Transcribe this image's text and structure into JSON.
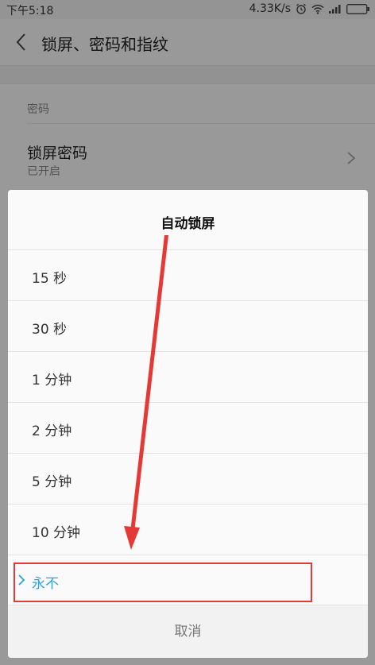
{
  "status_bar": {
    "time": "下午5:18",
    "speed": "4.33K/s"
  },
  "header": {
    "title": "锁屏、密码和指纹"
  },
  "background": {
    "section_label": "密码",
    "lock_password": {
      "title": "锁屏密码",
      "status": "已开启"
    }
  },
  "dialog": {
    "title": "自动锁屏",
    "options": [
      {
        "label": "15 秒",
        "selected": false
      },
      {
        "label": "30 秒",
        "selected": false
      },
      {
        "label": "1 分钟",
        "selected": false
      },
      {
        "label": "2 分钟",
        "selected": false
      },
      {
        "label": "5 分钟",
        "selected": false
      },
      {
        "label": "10 分钟",
        "selected": false
      },
      {
        "label": "永不",
        "selected": true
      }
    ],
    "cancel_label": "取消"
  },
  "colors": {
    "accent": "#2aa3e0",
    "annotation": "#e53935"
  }
}
